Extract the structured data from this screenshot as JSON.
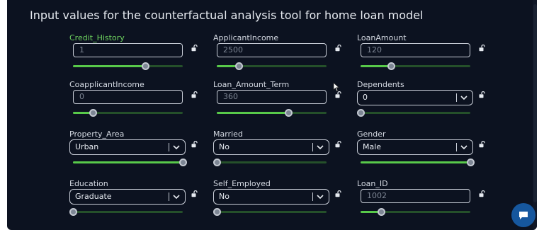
{
  "header": {
    "title": "Input values for the counterfactual analysis tool for home loan model"
  },
  "colors": {
    "background": "#0c1220",
    "active_label": "#6ed35f",
    "slider_fill": "#58c94a",
    "slider_track": "#25502a",
    "chat_button": "#16579e"
  },
  "fields": [
    {
      "name": "credit-history",
      "label": "Credit_History",
      "kind": "input",
      "value": "1",
      "slider": 0.66,
      "active": true
    },
    {
      "name": "applicant-income",
      "label": "ApplicantIncome",
      "kind": "input",
      "value": "2500",
      "slider": 0.2
    },
    {
      "name": "loan-amount",
      "label": "LoanAmount",
      "kind": "input",
      "value": "120",
      "slider": 0.28
    },
    {
      "name": "coapplicant-income",
      "label": "CoapplicantIncome",
      "kind": "input",
      "value": "0",
      "slider": 0.18
    },
    {
      "name": "loan-amount-term",
      "label": "Loan_Amount_Term",
      "kind": "input",
      "value": "360",
      "slider": 0.65
    },
    {
      "name": "dependents",
      "label": "Dependents",
      "kind": "select",
      "value": "0",
      "slider": 0.0
    },
    {
      "name": "property-area",
      "label": "Property_Area",
      "kind": "select",
      "value": "Urban",
      "slider": 1.0
    },
    {
      "name": "married",
      "label": "Married",
      "kind": "select",
      "value": "No",
      "slider": 0.0
    },
    {
      "name": "gender",
      "label": "Gender",
      "kind": "select",
      "value": "Male",
      "slider": 1.0
    },
    {
      "name": "education",
      "label": "Education",
      "kind": "select",
      "value": "Graduate",
      "slider": 0.0
    },
    {
      "name": "self-employed",
      "label": "Self_Employed",
      "kind": "select",
      "value": "No",
      "slider": 0.0
    },
    {
      "name": "loan-id",
      "label": "Loan_ID",
      "kind": "input",
      "value": "1002",
      "slider": 0.19
    }
  ],
  "icons": {
    "lock": "lock-open-icon",
    "chevron": "chevron-down-icon",
    "chat": "chat-bubble-icon",
    "cursor": "mouse-pointer-icon"
  }
}
